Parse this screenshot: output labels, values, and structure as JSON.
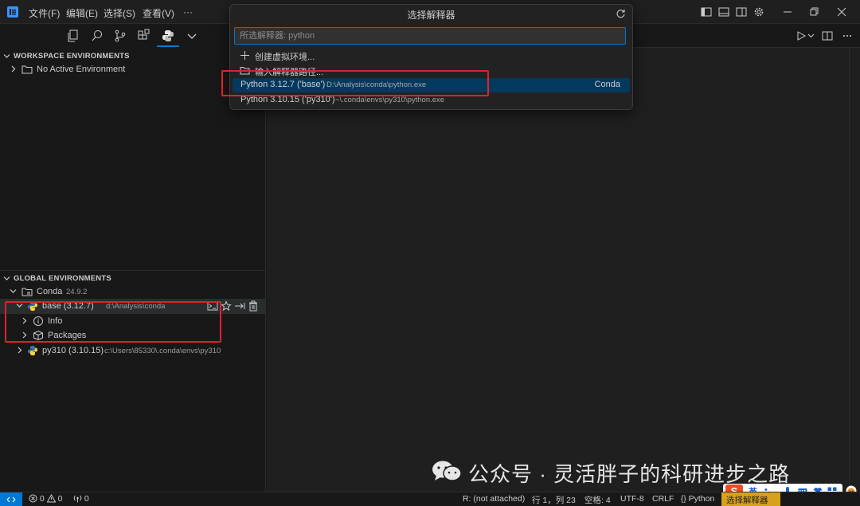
{
  "menu": {
    "file": "文件(F)",
    "edit": "编辑(E)",
    "select": "选择(S)",
    "view": "查看(V)",
    "more": "···"
  },
  "sidebar": {
    "workspace_header": "WORKSPACE ENVIRONMENTS",
    "no_active_env": "No Active Environment",
    "global_header": "GLOBAL ENVIRONMENTS",
    "conda_label": "Conda",
    "conda_version": "24.9.2",
    "base_label": "base (3.12.7)",
    "base_path": "d:\\Analysis\\conda",
    "info_label": "Info",
    "packages_label": "Packages",
    "py310_label": "py310 (3.10.15)",
    "py310_path": "c:\\Users\\85330\\.conda\\envs\\py310"
  },
  "quickpick": {
    "title": "选择解释器",
    "placeholder": "所选解释器: python",
    "items": [
      {
        "label": "创建虚拟环境...",
        "icon": "plus-icon"
      },
      {
        "label": "输入解释器路径...",
        "icon": "folder-icon"
      },
      {
        "label": "Python 3.12.7 ('base')",
        "desc": "D:\\Analysis\\conda\\python.exe",
        "detail": "Conda"
      },
      {
        "label": "Python 3.10.15 ('py310')",
        "desc": "~\\.conda\\envs\\py310\\python.exe"
      }
    ]
  },
  "watermark": {
    "text": "公众号 · 灵活胖子的科研进步之路"
  },
  "ime": {
    "logo": "S",
    "lang": "英",
    "punct": "•,"
  },
  "statusbar": {
    "errors": "0",
    "warnings": "0",
    "ports": "0",
    "r_status": "R: (not attached)",
    "position": "行 1，列 23",
    "spaces": "空格: 4",
    "encoding": "UTF-8",
    "eol": "CRLF",
    "language": "Python",
    "interpreter": "选择解释器"
  },
  "colors": {
    "accent": "#0078d4",
    "highlight": "#e0202b",
    "selection": "#04395e"
  }
}
